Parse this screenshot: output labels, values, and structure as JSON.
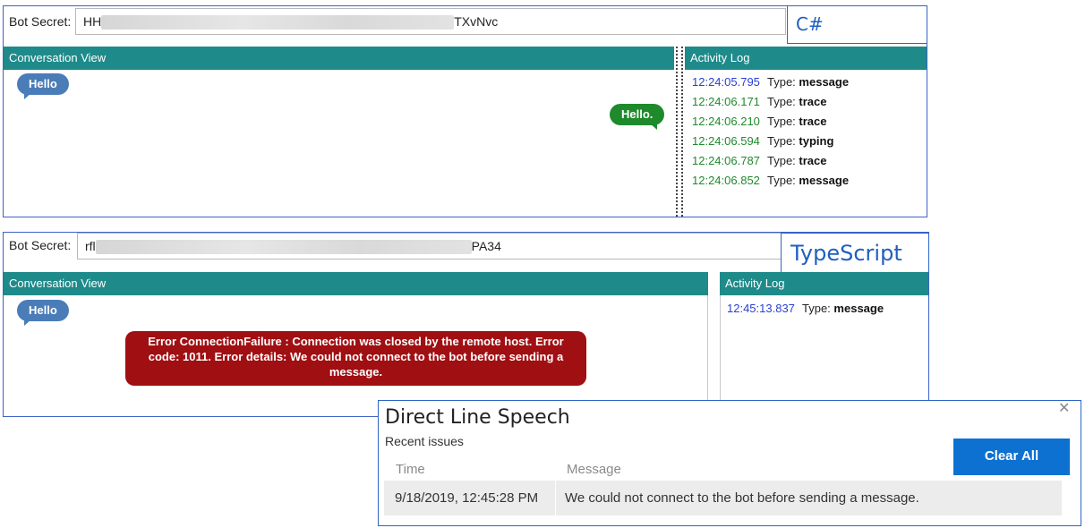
{
  "csharp": {
    "secret_label": "Bot Secret:",
    "secret_prefix": "HH",
    "secret_suffix": "TXvNvc",
    "tag": "C#",
    "conversation_header": "Conversation View",
    "activity_header": "Activity Log",
    "user_message": "Hello",
    "bot_message": "Hello.",
    "log": [
      {
        "time": "12:24:05.795",
        "type_label": "Type:",
        "type": "message",
        "color": "#2a3fd0"
      },
      {
        "time": "12:24:06.171",
        "type_label": "Type:",
        "type": "trace",
        "color": "#1f8a2c"
      },
      {
        "time": "12:24:06.210",
        "type_label": "Type:",
        "type": "trace",
        "color": "#1f8a2c"
      },
      {
        "time": "12:24:06.594",
        "type_label": "Type:",
        "type": "typing",
        "color": "#1f8a2c"
      },
      {
        "time": "12:24:06.787",
        "type_label": "Type:",
        "type": "trace",
        "color": "#1f8a2c"
      },
      {
        "time": "12:24:06.852",
        "type_label": "Type:",
        "type": "message",
        "color": "#1f8a2c"
      }
    ]
  },
  "typescript": {
    "secret_label": "Bot Secret:",
    "secret_prefix": "rfl",
    "secret_suffix": "PA34",
    "tag": "TypeScript",
    "conversation_header": "Conversation View",
    "activity_header": "Activity Log",
    "user_message": "Hello",
    "error_message": "Error ConnectionFailure : Connection was closed by the remote host. Error code: 1011. Error details: We could not connect to the bot before sending a message.",
    "log": [
      {
        "time": "12:45:13.837",
        "type_label": "Type:",
        "type": "message",
        "color": "#2a3fd0"
      }
    ]
  },
  "notification": {
    "title": "Direct Line Speech",
    "subtitle": "Recent issues",
    "clear_all": "Clear All",
    "close_icon": "close-icon",
    "columns": [
      "Time",
      "Message"
    ],
    "issues": [
      {
        "time": "9/18/2019, 12:45:28 PM",
        "message": "We could not connect to the bot before sending a message."
      }
    ]
  },
  "colors": {
    "header_teal": "#1f8a8a",
    "frame_blue": "#3f62c8",
    "user_bubble": "#4a7db8",
    "bot_bubble": "#1f8a2c",
    "error_red": "#a00f12",
    "button_blue": "#0d71d1"
  }
}
